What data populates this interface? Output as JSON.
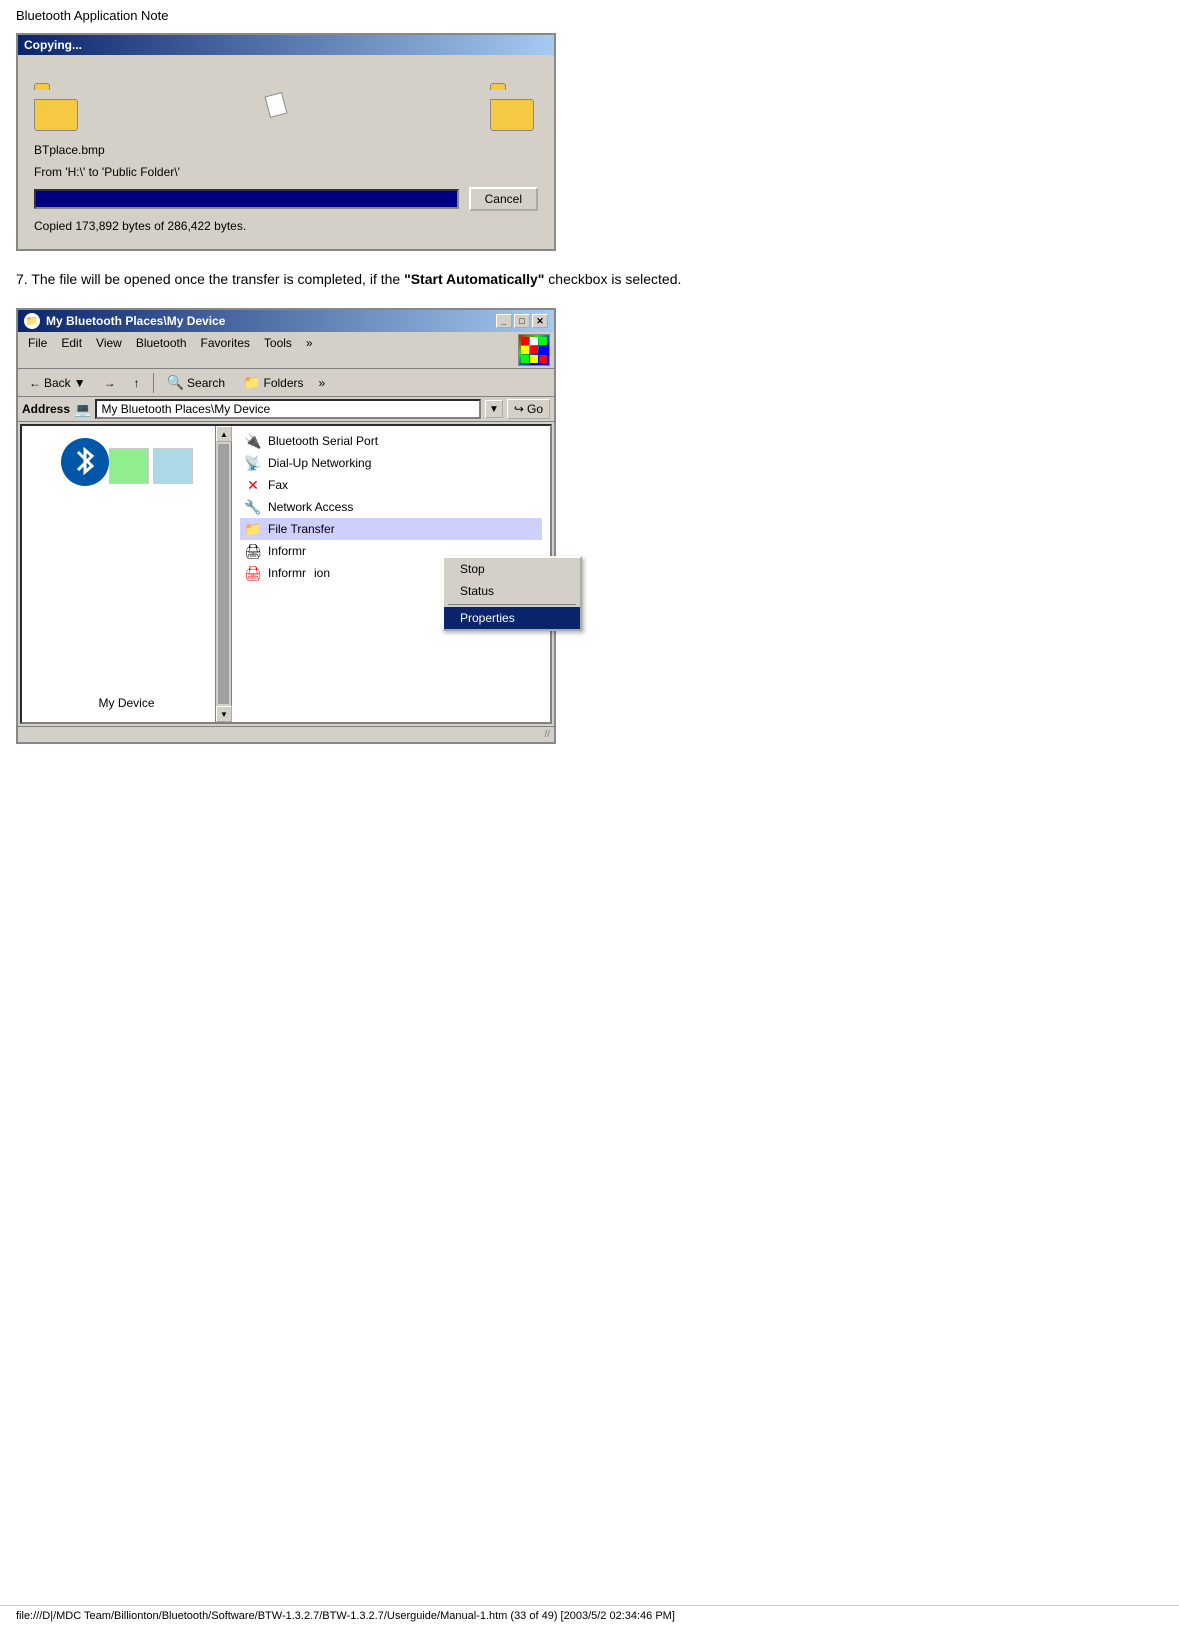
{
  "page": {
    "header": "Bluetooth Application Note",
    "footer": "file:///D|/MDC Team/Billionton/Bluetooth/Software/BTW-1.3.2.7/BTW-1.3.2.7/Userguide/Manual-1.htm (33 of 49) [2003/5/2 02:34:46 PM]"
  },
  "copying_dialog": {
    "title": "Copying...",
    "filename": "BTplace.bmp",
    "from_to": "From 'H:\\' to 'Public Folder\\'",
    "status": "Copied 173,892 bytes of 286,422 bytes.",
    "cancel_btn": "Cancel",
    "progress_segments": 9
  },
  "description": "7. The file will be opened once the transfer is completed, if the \"Start Automatically\" checkbox is selected.",
  "explorer_window": {
    "title": "My Bluetooth Places\\My Device",
    "titlebar_buttons": [
      "_",
      "□",
      "✕"
    ],
    "menubar": [
      "File",
      "Edit",
      "View",
      "Bluetooth",
      "Favorites",
      "Tools",
      "»"
    ],
    "toolbar": {
      "back": "Back",
      "forward": "→",
      "up": "↑",
      "search": "Search",
      "folders": "Folders",
      "chevron": "»"
    },
    "address": {
      "label": "Address",
      "value": "My Bluetooth Places\\My Device",
      "go": "Go"
    },
    "left_panel": {
      "device_label": "My Device"
    },
    "services": [
      {
        "name": "Bluetooth Serial Port",
        "icon": "🔌"
      },
      {
        "name": "Dial-Up Networking",
        "icon": "📡"
      },
      {
        "name": "Fax",
        "icon": "📠"
      },
      {
        "name": "Network Access",
        "icon": "🔧"
      },
      {
        "name": "File Transfer",
        "icon": "📁",
        "highlighted": true
      },
      {
        "name": "Informr",
        "icon": "🖨",
        "partial": true
      },
      {
        "name": "Informr",
        "icon": "🖨",
        "partial": true,
        "suffix": "ion"
      }
    ],
    "context_menu": {
      "items": [
        "Stop",
        "Status"
      ],
      "separator": true,
      "properties": "Properties"
    }
  }
}
